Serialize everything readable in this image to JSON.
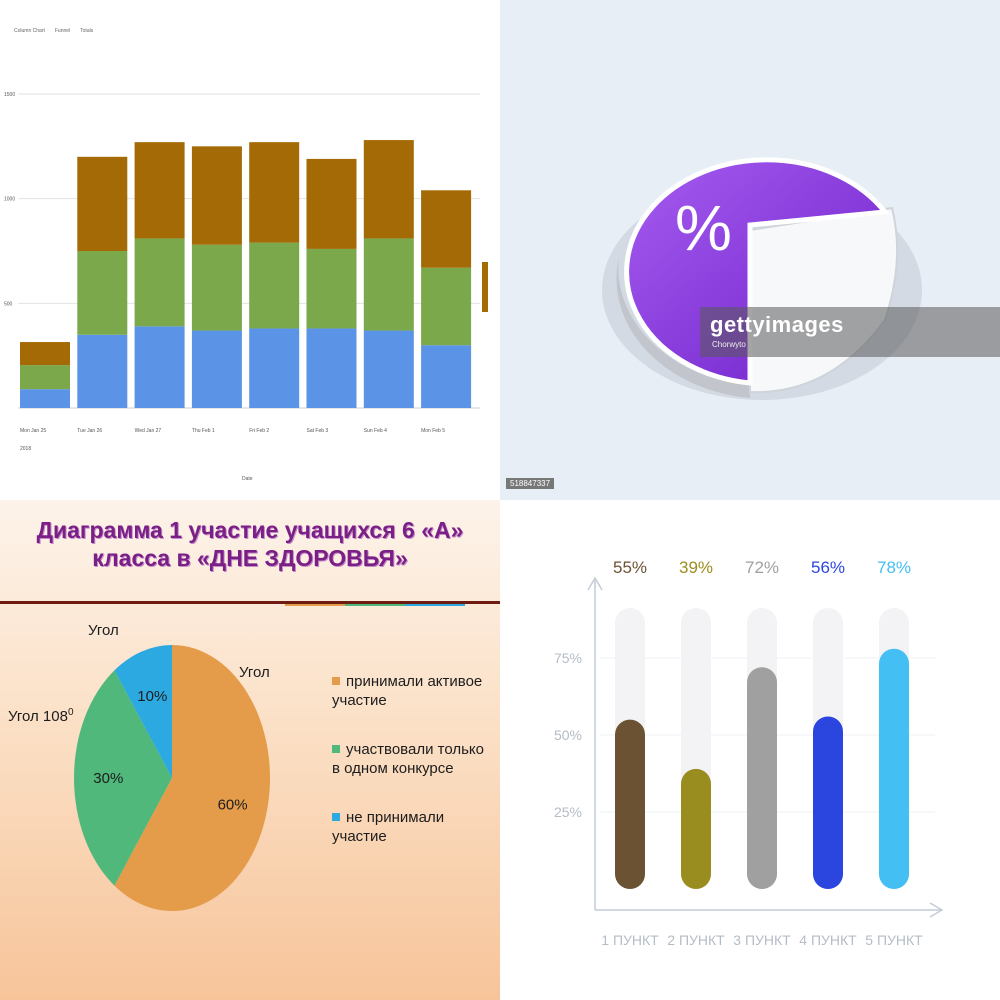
{
  "panel1": {
    "legend": [
      "Column Chart",
      "Funnel",
      "Totals"
    ],
    "y_ticks": [
      "1500",
      "1000",
      "500"
    ],
    "x_labels": [
      "Mon Jan 25",
      "Tue Jan 26",
      "Wed Jan 27",
      "Thu Feb 1",
      "Fri Feb 2",
      "Sat Feb 3",
      "Sun Feb 4",
      "Mon Feb 5"
    ],
    "x_sub": "2018",
    "x_title": "Date"
  },
  "panel2": {
    "symbol": "%",
    "watermark": "gettyimages",
    "watermark_sub": "Chorwyto",
    "stock_id": "518847337"
  },
  "panel3": {
    "title_line1": "Диаграмма 1 участие учащихся 6 «А»",
    "title_line2": "класса  в «ДНЕ ЗДОРОВЬЯ»",
    "label_top": "Угол",
    "label_right": "Угол",
    "label_left": "Угол 108",
    "label_left_sup": "0",
    "legend": [
      {
        "text": "принимали активое участие",
        "color": "#e59c4a"
      },
      {
        "text": "участвовали только в одном конкурсе",
        "color": "#4fb87a"
      },
      {
        "text": "не принимали участие",
        "color": "#2ca9e1"
      }
    ]
  },
  "chart_data": [
    {
      "type": "bar",
      "stacked": true,
      "categories": [
        "Mon Jan 25",
        "Tue Jan 26",
        "Wed Jan 27",
        "Thu Feb 1",
        "Fri Feb 2",
        "Sat Feb 3",
        "Sun Feb 4",
        "Mon Feb 5"
      ],
      "series": [
        {
          "color": "#5b93e6",
          "values": [
            90,
            350,
            390,
            370,
            380,
            380,
            370,
            300
          ]
        },
        {
          "color": "#7aa84a",
          "values": [
            115,
            400,
            420,
            410,
            410,
            380,
            440,
            370
          ]
        },
        {
          "color": "#a36a06",
          "values": [
            110,
            450,
            460,
            470,
            480,
            430,
            470,
            370
          ]
        }
      ],
      "ylim": [
        0,
        1500
      ],
      "grid": true
    },
    {
      "type": "pie",
      "labels": [
        "",
        ""
      ],
      "values": [
        75,
        25
      ],
      "colors": [
        "#8c3fe0",
        "#f4f7f9"
      ]
    },
    {
      "type": "pie",
      "labels": [
        "принимали активое участие",
        "участвовали только в одном конкурсе",
        "не принимали участие"
      ],
      "values": [
        60,
        30,
        10
      ],
      "value_labels": [
        "60%",
        "30%",
        "10%"
      ],
      "colors": [
        "#e59c4a",
        "#4fb87a",
        "#2ca9e1"
      ]
    },
    {
      "type": "bar",
      "categories": [
        "1 ПУНКТ",
        "2 ПУНКТ",
        "3 ПУНКТ",
        "4 ПУНКТ",
        "5 ПУНКТ"
      ],
      "values": [
        55,
        39,
        72,
        56,
        78
      ],
      "value_labels": [
        "55%",
        "39%",
        "72%",
        "56%",
        "78%"
      ],
      "colors": [
        "#6b5232",
        "#9a8d1f",
        "#a0a0a0",
        "#2b45df",
        "#43bff3"
      ],
      "y_ticks": [
        "25%",
        "50%",
        "75%"
      ],
      "ylim": [
        0,
        100
      ],
      "grid": true
    }
  ]
}
